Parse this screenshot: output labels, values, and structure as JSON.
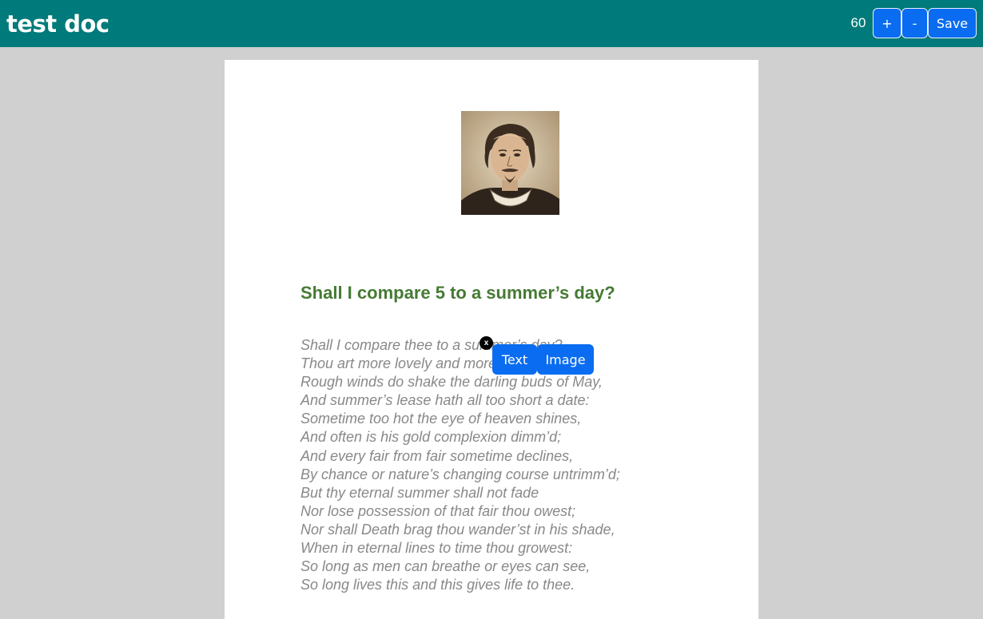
{
  "header": {
    "title": "test doc",
    "zoom": "60",
    "zoom_in_label": "+",
    "zoom_out_label": "-",
    "save_label": "Save"
  },
  "document": {
    "heading": "Shall I compare 5 to a summer’s day?",
    "poem_lines": [
      "Shall I compare thee to a summer’s day?",
      "Thou art more lovely and more temperate:",
      "Rough winds do shake the darling buds of May,",
      "And summer’s lease hath all too short a date:",
      "Sometime too hot the eye of heaven shines,",
      "And often is his gold complexion dimm’d;",
      "And every fair from fair sometime declines,",
      "By chance or nature’s changing course untrimm’d;",
      "But thy eternal summer shall not fade",
      "Nor lose possession of that fair thou owest;",
      "Nor shall Death brag thou wander’st in his shade,",
      "When in eternal lines to time thou growest:",
      "So long as men can breathe or eyes can see,",
      "So long lives this and this gives life to thee."
    ]
  },
  "insert_popup": {
    "close_label": "x",
    "text_label": "Text",
    "image_label": "Image"
  }
}
